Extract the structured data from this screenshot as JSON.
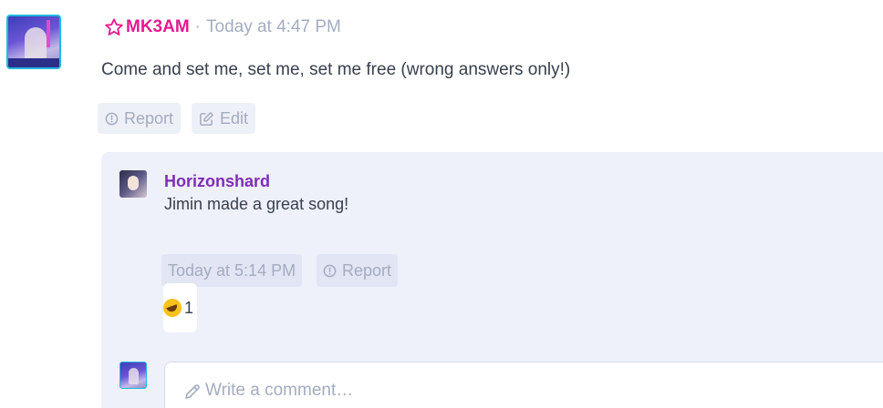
{
  "post": {
    "author": "MK3AM",
    "separator": "·",
    "timestamp": "Today at 4:47 PM",
    "body": "Come and set me, set me, set me free (wrong answers only!)",
    "actions": {
      "report": "Report",
      "edit": "Edit"
    }
  },
  "comment": {
    "author": "Horizonshard",
    "body": "Jimin made a great song!",
    "timestamp": "Today at 5:14 PM",
    "report": "Report",
    "reaction": {
      "emoji": "rolling-on-floor-laughing",
      "count": "1"
    }
  },
  "composer": {
    "placeholder": "Write a comment…"
  },
  "colors": {
    "author": "#e6198f",
    "comment_author": "#7e2db4",
    "muted": "#a4acc0",
    "thread_bg": "#eef0fa"
  }
}
